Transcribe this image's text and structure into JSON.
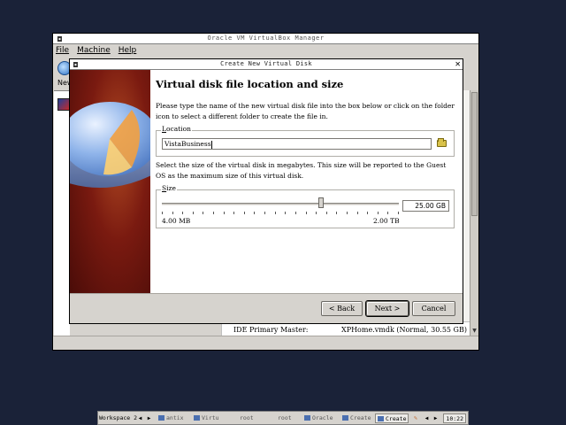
{
  "main_window": {
    "title": "Oracle VM VirtualBox Manager",
    "menu": [
      "File",
      "Machine",
      "Help"
    ],
    "toolbar": {
      "new_label": "New"
    },
    "details": {
      "key": "IDE Primary Master:",
      "value": "XPHome.vmdk (Normal, 30.55 GB)"
    }
  },
  "dialog": {
    "title": "Create New Virtual Disk",
    "heading": "Virtual disk file location and size",
    "intro": "Please type the name of the new virtual disk file into the box below or click on the folder icon to select a different folder to create the file in.",
    "location": {
      "legend": "Location",
      "value": "VistaBusiness"
    },
    "size_text": "Select the size of the virtual disk in megabytes. This size will be reported to the Guest OS as the maximum size of this virtual disk.",
    "size": {
      "legend": "Size",
      "value": "25.00 GB",
      "min_label": "4.00 MB",
      "max_label": "2.00 TB",
      "slider_fraction": 0.67
    },
    "buttons": {
      "back": "< Back",
      "next": "Next >",
      "cancel": "Cancel"
    }
  },
  "taskbar": {
    "workspace": "Workspace 2",
    "tasks": [
      "antix",
      "Virtu",
      "root",
      "root",
      "Oracle",
      "Create"
    ],
    "active_task": "Create",
    "clock": "10:22"
  }
}
